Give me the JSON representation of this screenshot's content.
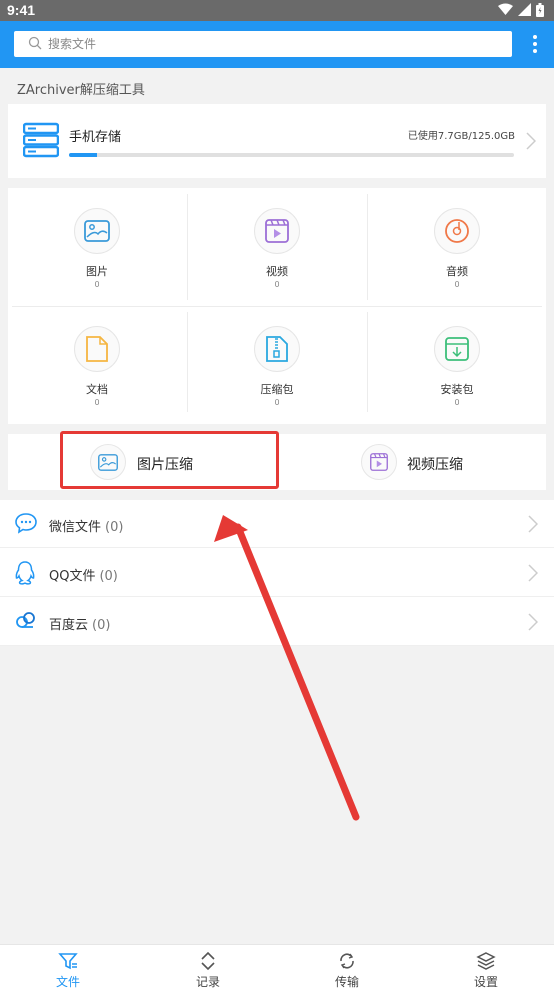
{
  "status_bar": {
    "time": "9:41"
  },
  "search": {
    "placeholder": "搜索文件"
  },
  "app_title": "ZArchiver解压缩工具",
  "storage": {
    "name": "手机存储",
    "usage": "已使用7.7GB/125.0GB",
    "used_fraction": 0.062
  },
  "categories": [
    {
      "label": "图片",
      "count": "0",
      "icon": "image-icon",
      "color": "#3a9ad9"
    },
    {
      "label": "视频",
      "count": "0",
      "icon": "video-icon",
      "color": "#9c6fd6"
    },
    {
      "label": "音频",
      "count": "0",
      "icon": "music-icon",
      "color": "#f07848"
    },
    {
      "label": "文档",
      "count": "0",
      "icon": "document-icon",
      "color": "#f5b642"
    },
    {
      "label": "压缩包",
      "count": "0",
      "icon": "zip-icon",
      "color": "#2aa8e0"
    },
    {
      "label": "安装包",
      "count": "0",
      "icon": "install-package-icon",
      "color": "#3cbf7a"
    }
  ],
  "compress": {
    "image": "图片压缩",
    "video": "视频压缩"
  },
  "sources": [
    {
      "label": "微信文件",
      "count": "(0)",
      "icon": "wechat-icon"
    },
    {
      "label": "QQ文件",
      "count": "(0)",
      "icon": "qq-icon"
    },
    {
      "label": "百度云",
      "count": "(0)",
      "icon": "baidu-cloud-icon"
    }
  ],
  "tabs": [
    {
      "label": "文件",
      "icon": "files-icon",
      "active": true
    },
    {
      "label": "记录",
      "icon": "records-icon",
      "active": false
    },
    {
      "label": "传输",
      "icon": "transfer-icon",
      "active": false
    },
    {
      "label": "设置",
      "icon": "settings-icon",
      "active": false
    }
  ],
  "colors": {
    "accent": "#2196f3",
    "highlight": "#e53935",
    "statusbar": "#6a6a6a"
  }
}
